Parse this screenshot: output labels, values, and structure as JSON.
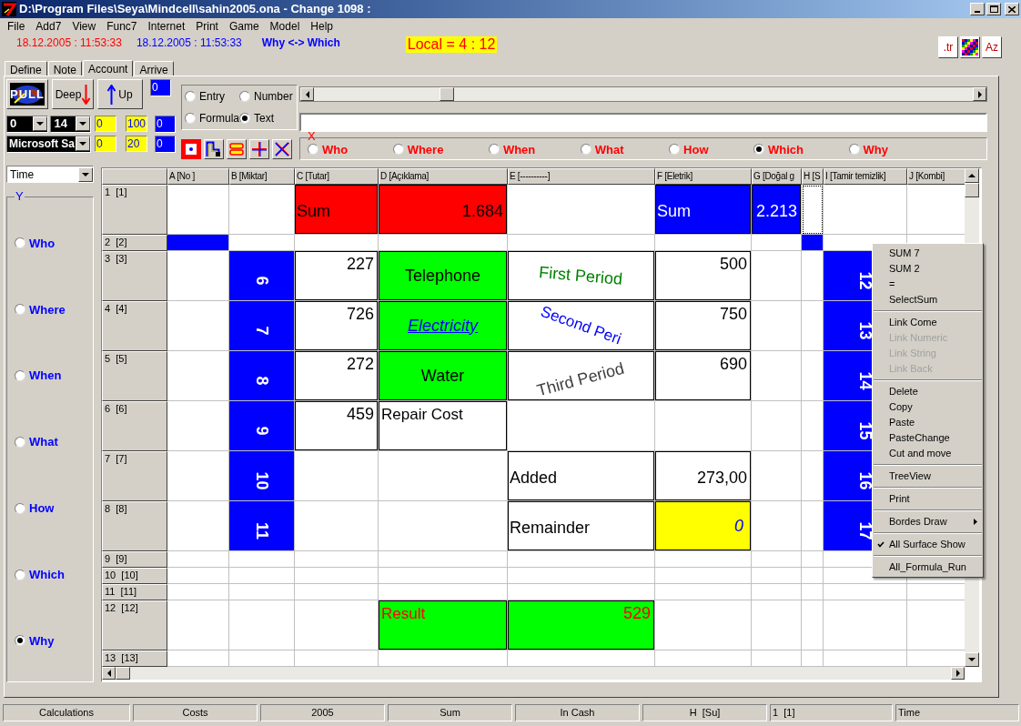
{
  "window": {
    "title": "D:\\Program Files\\Seya\\Mindcell\\sahin2005.ona - Change 1098 :"
  },
  "menu": [
    "File",
    "Add7",
    "View",
    "Func7",
    "Internet",
    "Print",
    "Game",
    "Model",
    "Help"
  ],
  "info": {
    "date_red": "18.12.2005 : 11:53:33",
    "date_blue": "18.12.2005 : 11:53:33",
    "mode": "Why <-> Which",
    "local": "Local = 4 : 12"
  },
  "top_right_buttons": [
    {
      "kind": "text",
      "label": ".tr"
    },
    {
      "kind": "grid"
    },
    {
      "kind": "text",
      "label": "Az"
    }
  ],
  "tabs": [
    {
      "label": "Define",
      "selected": false
    },
    {
      "label": "Note",
      "selected": false
    },
    {
      "label": "Account",
      "selected": true
    },
    {
      "label": "Arrive",
      "selected": false
    }
  ],
  "toolbar": {
    "pull": "PULL",
    "deep": "Deep",
    "up": "Up",
    "counters": [
      "0",
      "0",
      "0"
    ],
    "combo_color": "0",
    "combo_size": "14",
    "combo_font": "Microsoft Sa",
    "yellow": [
      "0",
      "100",
      "0",
      "20"
    ]
  },
  "entry_mode": [
    {
      "label": "Entry",
      "selected": false
    },
    {
      "label": "Number",
      "selected": false
    },
    {
      "label": "Formula",
      "selected": false
    },
    {
      "label": "Text",
      "selected": true
    }
  ],
  "draw_tools": [
    {
      "kind": "dot",
      "selected": true
    },
    {
      "kind": "steps",
      "selected": false
    },
    {
      "kind": "bars",
      "selected": false
    },
    {
      "kind": "cross",
      "selected": false
    },
    {
      "kind": "diagonal",
      "selected": false
    }
  ],
  "slider": {
    "level": 0.19
  },
  "x_axis": {
    "label": "X",
    "options": [
      {
        "label": "Who",
        "selected": false
      },
      {
        "label": "Where",
        "selected": false
      },
      {
        "label": "When",
        "selected": false
      },
      {
        "label": "What",
        "selected": false
      },
      {
        "label": "How",
        "selected": false
      },
      {
        "label": "Which",
        "selected": true
      },
      {
        "label": "Why",
        "selected": false
      }
    ]
  },
  "y_axis": {
    "combo": "Time",
    "label": "Y",
    "options": [
      {
        "label": "Who",
        "selected": false
      },
      {
        "label": "Where",
        "selected": false
      },
      {
        "label": "When",
        "selected": false
      },
      {
        "label": "What",
        "selected": false
      },
      {
        "label": "How",
        "selected": false
      },
      {
        "label": "Which",
        "selected": false
      },
      {
        "label": "Why",
        "selected": true
      }
    ]
  },
  "sheet": {
    "columns": [
      "A [No ]",
      "B [Miktar]",
      "C [Tutar]",
      "D [Açıklama]",
      "E [----------]",
      "F [Eletrik]",
      "G [Doğal g",
      "H [S",
      "I [Tamir temizlik]",
      "J [Kombi]"
    ],
    "rows": [
      {
        "header": "1  [1]",
        "tall": true,
        "cells": [
          {},
          {},
          {
            "kind": "label",
            "text": "Sum",
            "color": "#ff0000",
            "boxed": true
          },
          {
            "kind": "value",
            "text": "1.684",
            "color": "#ff0000",
            "boxed": true
          },
          {},
          {
            "kind": "label-light",
            "text": "Sum",
            "color": "#0000ff",
            "boxed": true
          },
          {
            "kind": "value-light",
            "text": "2.213",
            "color": "#0000ff",
            "boxed": true
          },
          {
            "kind": "selected"
          },
          {},
          {}
        ]
      },
      {
        "header": "2  [2]",
        "tall": false,
        "cells": [
          {
            "kind": "fill",
            "color": "#0000ff"
          },
          {},
          {},
          {},
          {},
          {},
          {},
          {
            "kind": "fill",
            "color": "#0000ff"
          },
          {}
        ]
      },
      {
        "header": "3  [3]",
        "tall": true,
        "cells": [
          {},
          {
            "kind": "vertical",
            "text": "6",
            "color": "#0000ff"
          },
          {
            "kind": "number",
            "text": "227",
            "boxed": true
          },
          {
            "kind": "caption",
            "text": "Telephone",
            "color": "#00ff00",
            "boxed": true
          },
          {
            "kind": "slant-down",
            "text": "First Period",
            "boxed": true
          },
          {
            "kind": "number",
            "text": "500",
            "boxed": true
          },
          {},
          {},
          {
            "kind": "vertical",
            "text": "12",
            "color": "#0000ff"
          }
        ]
      },
      {
        "header": "4  [4]",
        "tall": true,
        "cells": [
          {},
          {
            "kind": "vertical",
            "text": "7",
            "color": "#0000ff"
          },
          {
            "kind": "number",
            "text": "726",
            "boxed": true
          },
          {
            "kind": "link",
            "text": "Electricity",
            "color": "#00ff00",
            "boxed": true
          },
          {
            "kind": "slant-steep",
            "text": "Second Peri",
            "boxed": true
          },
          {
            "kind": "number",
            "text": "750",
            "boxed": true
          },
          {},
          {},
          {
            "kind": "vertical",
            "text": "13",
            "color": "#0000ff"
          }
        ]
      },
      {
        "header": "5  [5]",
        "tall": true,
        "cells": [
          {},
          {
            "kind": "vertical",
            "text": "8",
            "color": "#0000ff"
          },
          {
            "kind": "number",
            "text": "272",
            "boxed": true
          },
          {
            "kind": "caption",
            "text": "Water",
            "color": "#00ff00",
            "boxed": true
          },
          {
            "kind": "slant-up",
            "text": "Third Period",
            "boxed": true
          },
          {
            "kind": "number",
            "text": "690",
            "boxed": true
          },
          {},
          {},
          {
            "kind": "vertical",
            "text": "14",
            "color": "#0000ff"
          }
        ]
      },
      {
        "header": "6  [6]",
        "tall": true,
        "cells": [
          {},
          {
            "kind": "vertical",
            "text": "9",
            "color": "#0000ff"
          },
          {
            "kind": "number",
            "text": "459",
            "boxed": true
          },
          {
            "kind": "note",
            "text": "Repair Cost",
            "boxed": true
          },
          {},
          {},
          {},
          {},
          {
            "kind": "vertical",
            "text": "15",
            "color": "#0000ff"
          },
          {}
        ]
      },
      {
        "header": "7  [7]",
        "tall": true,
        "cells": [
          {},
          {
            "kind": "vertical",
            "text": "10",
            "color": "#0000ff"
          },
          {},
          {},
          {
            "kind": "label",
            "text": "Added",
            "boxed": true
          },
          {
            "kind": "value",
            "text": "273,00",
            "boxed": true
          },
          {},
          {},
          {
            "kind": "vertical",
            "text": "16",
            "color": "#0000ff"
          },
          {}
        ]
      },
      {
        "header": "8  [8]",
        "tall": true,
        "cells": [
          {},
          {
            "kind": "vertical",
            "text": "11",
            "color": "#0000ff"
          },
          {},
          {},
          {
            "kind": "label",
            "text": "Remainder",
            "boxed": true
          },
          {
            "kind": "italic",
            "text": "0",
            "color": "#ffff00",
            "boxed": true
          },
          {},
          {},
          {
            "kind": "vertical",
            "text": "17",
            "color": "#0000ff"
          },
          {}
        ]
      },
      {
        "header": "9  [9]",
        "tall": false,
        "cells": [
          {},
          {},
          {},
          {},
          {},
          {},
          {},
          {},
          {},
          {}
        ]
      },
      {
        "header": "10  [10]",
        "tall": false,
        "cells": [
          {},
          {},
          {},
          {},
          {},
          {},
          {},
          {},
          {},
          {}
        ]
      },
      {
        "header": "11  [11]",
        "tall": false,
        "cells": [
          {},
          {},
          {},
          {},
          {},
          {},
          {},
          {},
          {},
          {}
        ]
      },
      {
        "header": "12  [12]",
        "tall": true,
        "cells": [
          {},
          {},
          {},
          {
            "kind": "note-alert",
            "text": "Result",
            "color": "#00ff00",
            "boxed": true
          },
          {
            "kind": "number-alert",
            "text": "529",
            "color": "#00ff00",
            "boxed": true
          },
          {},
          {},
          {},
          {},
          {}
        ]
      },
      {
        "header": "13  [13]",
        "tall": false,
        "cells": [
          {},
          {},
          {},
          {},
          {},
          {},
          {},
          {},
          {},
          {}
        ]
      }
    ]
  },
  "context_menu": [
    {
      "kind": "item",
      "label": "SUM 7",
      "disabled": false,
      "checked": false
    },
    {
      "kind": "item",
      "label": "SUM 2",
      "disabled": false,
      "checked": false
    },
    {
      "kind": "item",
      "label": "=",
      "disabled": false,
      "checked": false
    },
    {
      "kind": "item",
      "label": "SelectSum",
      "disabled": false,
      "checked": false
    },
    {
      "kind": "separator"
    },
    {
      "kind": "item",
      "label": "Link Come",
      "disabled": false,
      "checked": false
    },
    {
      "kind": "item",
      "label": "Link Numeric",
      "disabled": true,
      "checked": false
    },
    {
      "kind": "item",
      "label": "Link String",
      "disabled": true,
      "checked": false
    },
    {
      "kind": "item",
      "label": "Link Back",
      "disabled": true,
      "checked": false
    },
    {
      "kind": "separator"
    },
    {
      "kind": "item",
      "label": "Delete",
      "disabled": false,
      "checked": false
    },
    {
      "kind": "item",
      "label": "Copy",
      "disabled": false,
      "checked": false
    },
    {
      "kind": "item",
      "label": "Paste",
      "disabled": false,
      "checked": false
    },
    {
      "kind": "item",
      "label": "PasteChange",
      "disabled": false,
      "checked": false
    },
    {
      "kind": "item",
      "label": "Cut and move",
      "disabled": false,
      "checked": false
    },
    {
      "kind": "separator"
    },
    {
      "kind": "item",
      "label": "TreeView",
      "disabled": false,
      "checked": false
    },
    {
      "kind": "separator"
    },
    {
      "kind": "item",
      "label": "Print",
      "disabled": false,
      "checked": false
    },
    {
      "kind": "separator"
    },
    {
      "kind": "submenu",
      "label": "Bordes Draw",
      "disabled": false,
      "checked": false
    },
    {
      "kind": "separator"
    },
    {
      "kind": "item",
      "label": "All Surface Show",
      "disabled": false,
      "checked": true
    },
    {
      "kind": "separator"
    },
    {
      "kind": "item",
      "label": "All_Formula_Run",
      "disabled": false,
      "checked": false
    }
  ],
  "status_bar": [
    "Calculations",
    "Costs",
    "2005",
    "Sum",
    "In Cash",
    "H  [Su]",
    "1  [1]",
    "Time"
  ]
}
